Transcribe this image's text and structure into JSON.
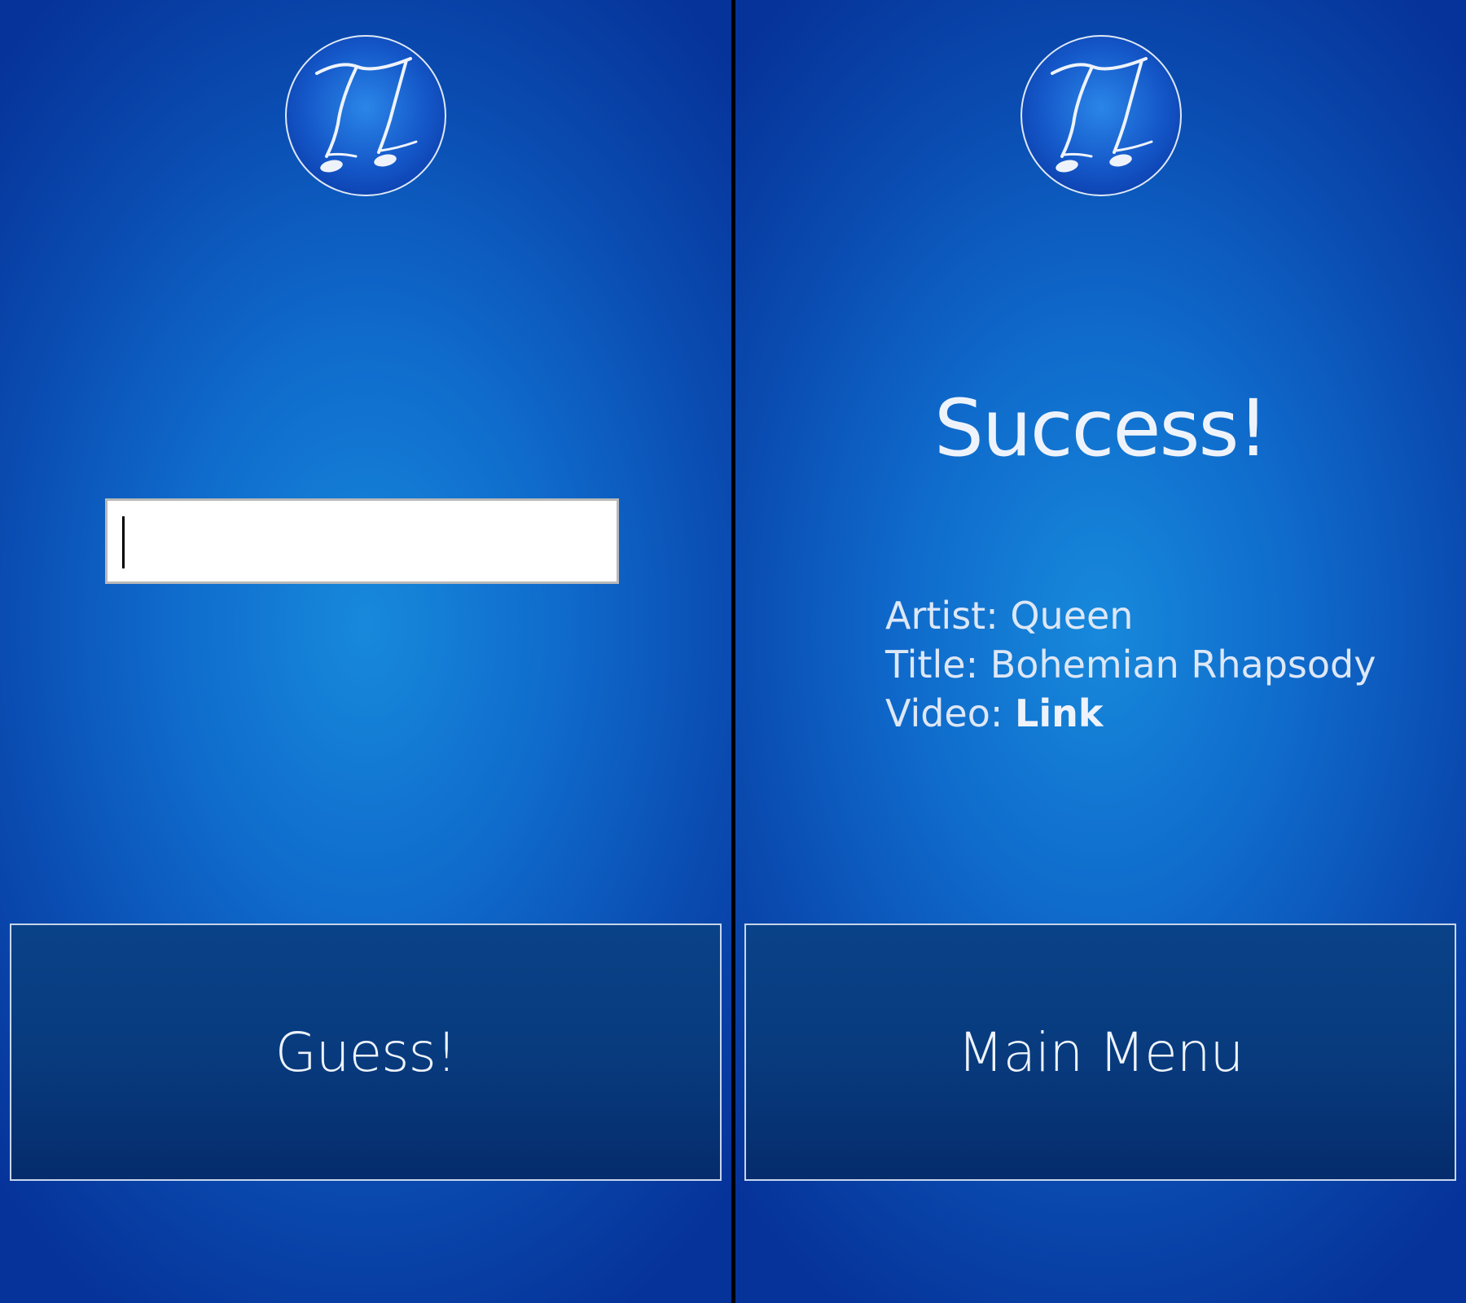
{
  "colors": {
    "background": "#1789db",
    "background_edge": "#063399",
    "button_fill": "#083b7e",
    "text": "#eef3fb",
    "divider": "#000000"
  },
  "guess_screen": {
    "logo_icon": "music-note-logo-icon",
    "input": {
      "value": "",
      "placeholder": ""
    },
    "guess_button_label": "Guess!"
  },
  "result_screen": {
    "logo_icon": "music-note-logo-icon",
    "heading": "Success!",
    "artist": {
      "label": "Artist:",
      "value": "Queen"
    },
    "title": {
      "label": "Title:",
      "value": "Bohemian Rhapsody"
    },
    "video": {
      "label": "Video:",
      "link_text": "Link"
    },
    "main_menu_button_label": "Main Menu"
  }
}
